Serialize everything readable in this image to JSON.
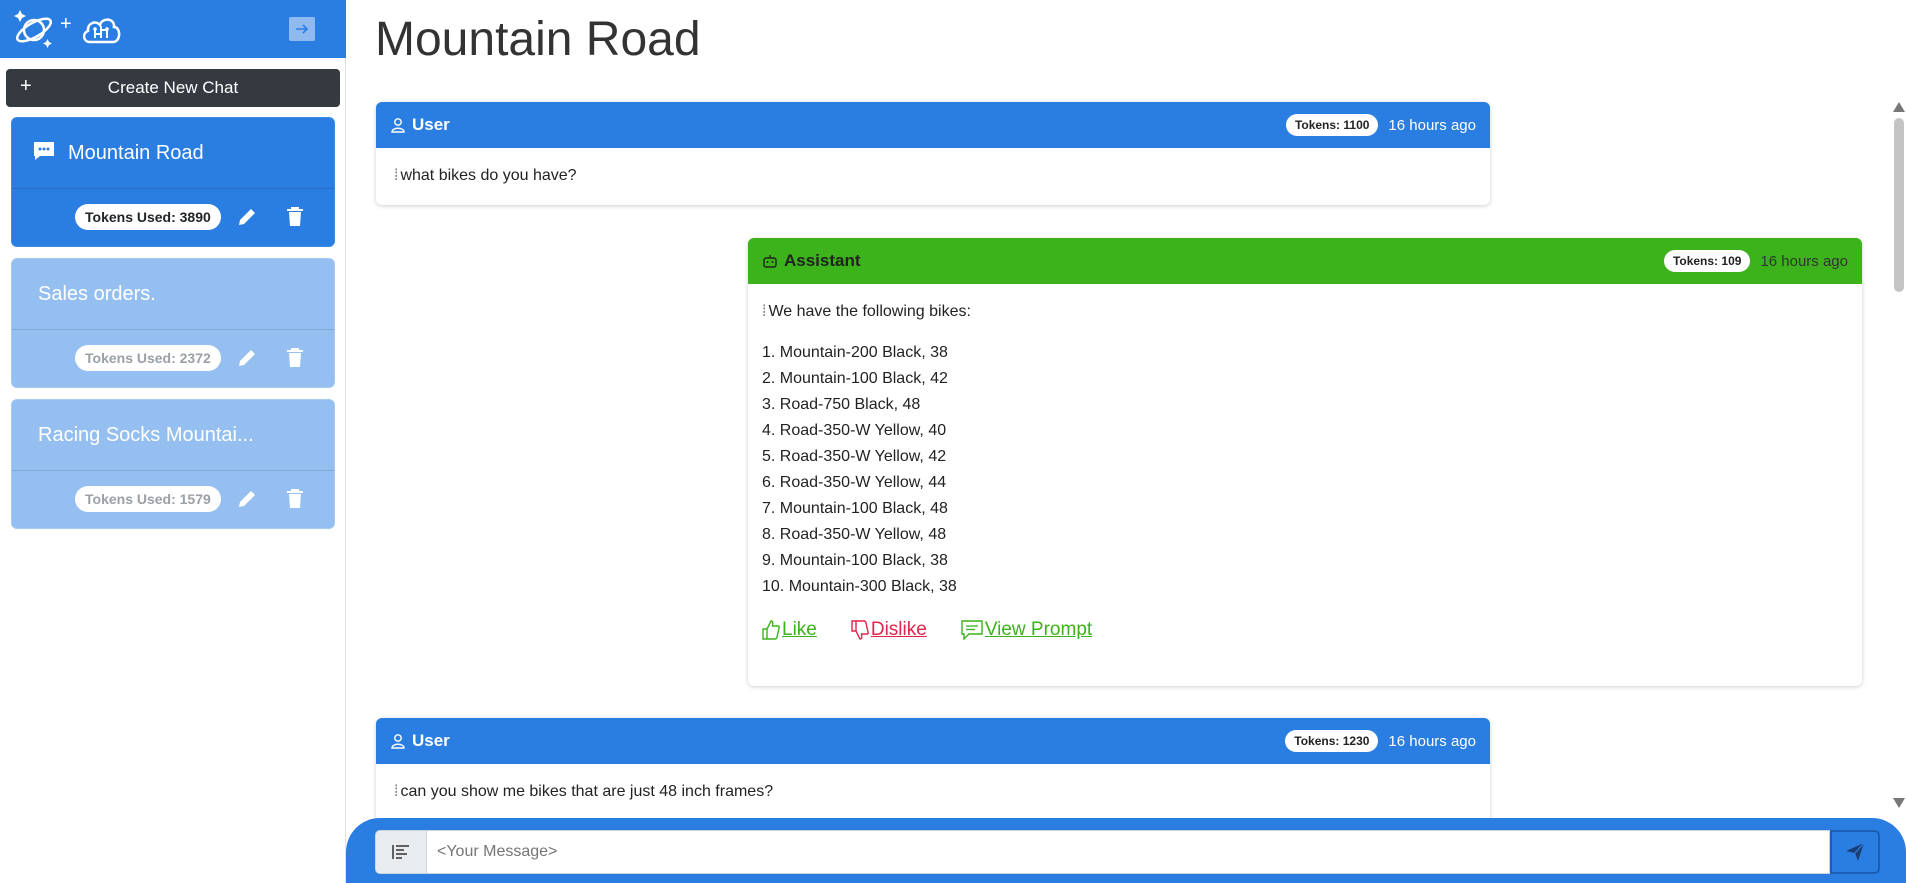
{
  "sidebar": {
    "new_chat_label": "Create New Chat",
    "chats": [
      {
        "title": "Mountain Road",
        "tokens": "Tokens Used: 3890"
      },
      {
        "title": "Sales orders.",
        "tokens": "Tokens Used: 2372"
      },
      {
        "title": "Racing Socks Mountai...",
        "tokens": "Tokens Used: 1579"
      }
    ]
  },
  "page_title": "Mountain Road",
  "messages": [
    {
      "role": "User",
      "tokens": "Tokens: 1100",
      "time": "16 hours ago",
      "text": "what bikes do you have?"
    },
    {
      "role": "Assistant",
      "tokens": "Tokens: 109",
      "time": "16 hours ago",
      "intro": "We have the following bikes:",
      "items": [
        "1. Mountain-200 Black, 38",
        "2. Mountain-100 Black, 42",
        "3. Road-750 Black, 48",
        "4. Road-350-W Yellow, 40",
        "5. Road-350-W Yellow, 42",
        "6. Road-350-W Yellow, 44",
        "7. Mountain-100 Black, 48",
        "8. Road-350-W Yellow, 48",
        "9. Mountain-100 Black, 38",
        "10. Mountain-300 Black, 38"
      ],
      "actions": {
        "like": "Like",
        "dislike": "Dislike",
        "view_prompt": "View Prompt"
      }
    },
    {
      "role": "User",
      "tokens": "Tokens: 1230",
      "time": "16 hours ago",
      "text": "can you show me bikes that are just 48 inch frames?"
    }
  ],
  "composer": {
    "placeholder": "<Your Message>"
  },
  "colors": {
    "primary": "#2a7de1",
    "assistant": "#3cb31a",
    "dislike": "#e0244a",
    "dark_button": "#343a40"
  }
}
